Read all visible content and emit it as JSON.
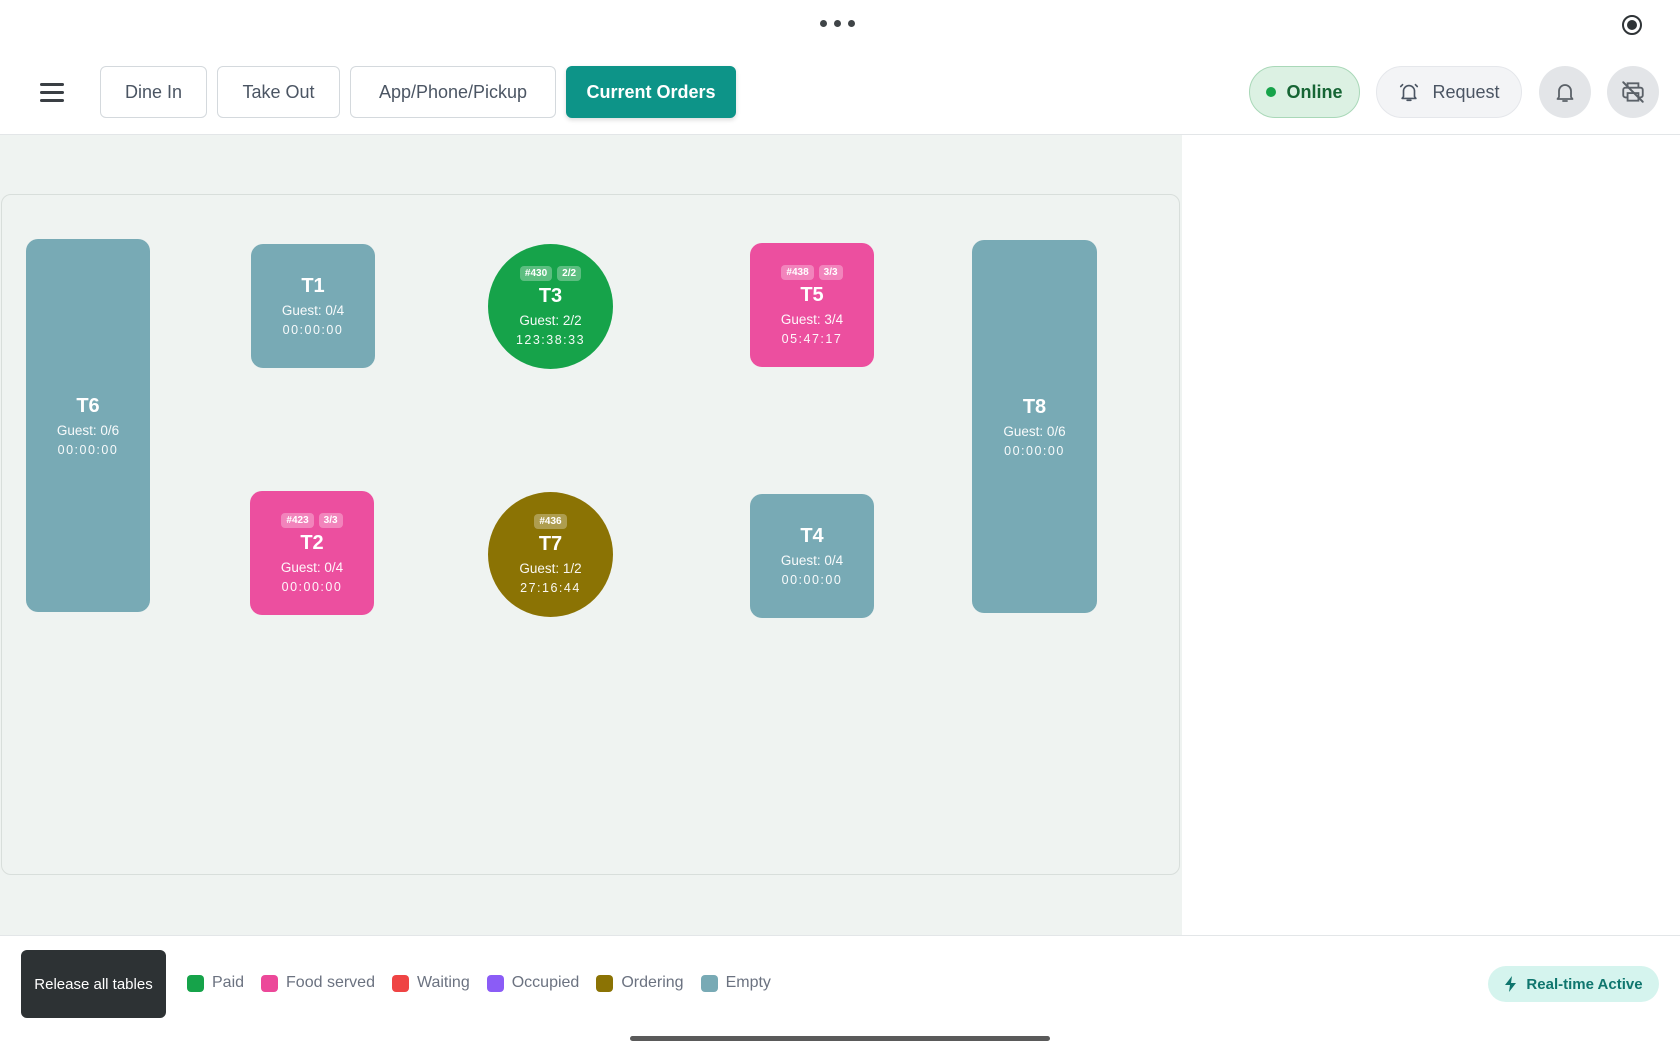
{
  "header": {
    "tabs": [
      {
        "label": "Dine In"
      },
      {
        "label": "Take Out"
      },
      {
        "label": "App/Phone/Pickup"
      },
      {
        "label": "Current Orders"
      }
    ],
    "active_tab": "Current Orders",
    "status_label": "Online",
    "request_label": "Request"
  },
  "tables": {
    "T6": {
      "name": "T6",
      "guest": "Guest: 0/6",
      "time": "00:00:00",
      "status": "Empty"
    },
    "T1": {
      "name": "T1",
      "guest": "Guest: 0/4",
      "time": "00:00:00",
      "status": "Empty"
    },
    "T3": {
      "name": "T3",
      "order": "#430",
      "count": "2/2",
      "guest": "Guest: 2/2",
      "time": "123:38:33",
      "status": "Paid"
    },
    "T5": {
      "name": "T5",
      "order": "#438",
      "count": "3/3",
      "guest": "Guest: 3/4",
      "time": "05:47:17",
      "status": "Food served"
    },
    "T8": {
      "name": "T8",
      "guest": "Guest: 0/6",
      "time": "00:00:00",
      "status": "Empty"
    },
    "T2": {
      "name": "T2",
      "order": "#423",
      "count": "3/3",
      "guest": "Guest: 0/4",
      "time": "00:00:00",
      "status": "Food served"
    },
    "T7": {
      "name": "T7",
      "order": "#436",
      "guest": "Guest: 1/2",
      "time": "27:16:44",
      "status": "Ordering"
    },
    "T4": {
      "name": "T4",
      "guest": "Guest: 0/4",
      "time": "00:00:00",
      "status": "Empty"
    }
  },
  "bottom": {
    "release_label": "Release all tables",
    "legend": [
      {
        "label": "Paid",
        "color": "#16a34a"
      },
      {
        "label": "Food served",
        "color": "#ec4899"
      },
      {
        "label": "Waiting",
        "color": "#ef4444"
      },
      {
        "label": "Occupied",
        "color": "#8b5cf6"
      },
      {
        "label": "Ordering",
        "color": "#8b7304"
      },
      {
        "label": "Empty",
        "color": "#78aab5"
      }
    ],
    "realtime_label": "Real-time Active"
  },
  "colors": {
    "accent": "#0d9488",
    "paid": "#16a34a",
    "food_served": "#ec4f9f",
    "ordering": "#8b7304",
    "empty": "#78aab5"
  }
}
